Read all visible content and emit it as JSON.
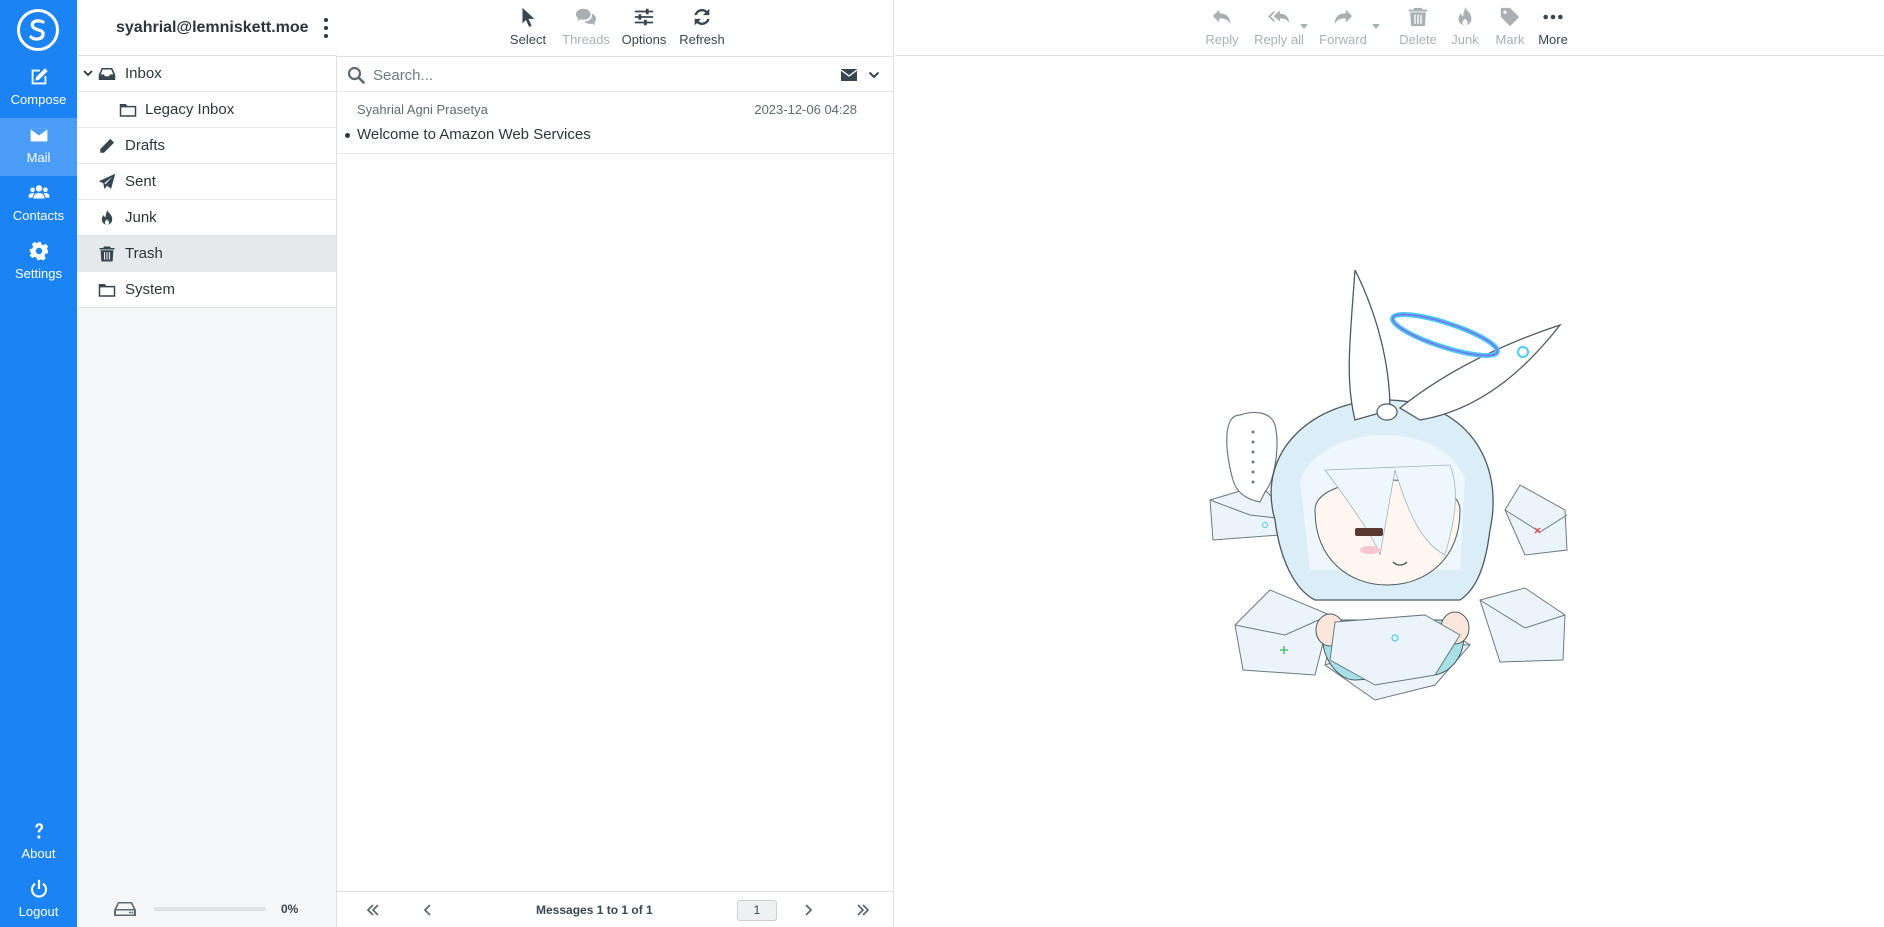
{
  "nav": {
    "items": [
      {
        "label": "Compose",
        "icon": "compose-icon"
      },
      {
        "label": "Mail",
        "icon": "envelope-icon",
        "active": true
      },
      {
        "label": "Contacts",
        "icon": "users-icon"
      },
      {
        "label": "Settings",
        "icon": "gear-icon"
      }
    ],
    "bottom": [
      {
        "label": "About",
        "icon": "question-icon"
      },
      {
        "label": "Logout",
        "icon": "power-icon"
      }
    ]
  },
  "account": {
    "email": "syahrial@lemniskett.moe"
  },
  "folders": [
    {
      "label": "Inbox",
      "icon": "inbox-icon",
      "expanded": true
    },
    {
      "label": "Legacy Inbox",
      "icon": "folder-icon",
      "child": true
    },
    {
      "label": "Drafts",
      "icon": "pencil-icon"
    },
    {
      "label": "Sent",
      "icon": "paper-plane-icon"
    },
    {
      "label": "Junk",
      "icon": "fire-icon"
    },
    {
      "label": "Trash",
      "icon": "trash-icon",
      "selected": true
    },
    {
      "label": "System",
      "icon": "folder-icon"
    }
  ],
  "quota": {
    "percent_label": "0%",
    "value": 0
  },
  "list_toolbar": {
    "select": "Select",
    "threads": "Threads",
    "options": "Options",
    "refresh": "Refresh"
  },
  "search": {
    "placeholder": "Search..."
  },
  "messages": [
    {
      "from": "Syahrial Agni Prasetya",
      "date": "2023-12-06 04:28",
      "subject": "Welcome to Amazon Web Services",
      "unread": true
    }
  ],
  "pager": {
    "count_label": "Messages 1 to 1 of 1",
    "page": "1"
  },
  "preview_toolbar": {
    "reply": "Reply",
    "reply_all": "Reply all",
    "forward": "Forward",
    "delete": "Delete",
    "junk": "Junk",
    "mark": "Mark",
    "more": "More"
  },
  "colors": {
    "accent": "#1b83f3",
    "nav_active": "#4a9cf5",
    "disabled": "#a8b0b4"
  }
}
